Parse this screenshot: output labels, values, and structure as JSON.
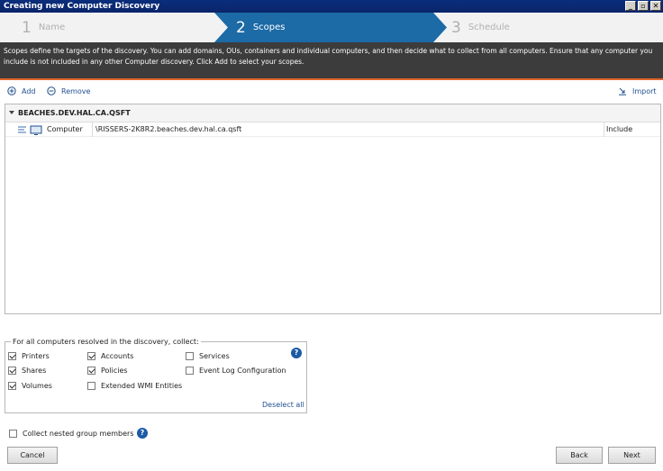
{
  "window": {
    "title": "Creating new Computer Discovery",
    "buttons": [
      "_",
      "▫",
      "✕"
    ]
  },
  "wizard": {
    "steps": [
      {
        "num": "1",
        "label": "Name"
      },
      {
        "num": "2",
        "label": "Scopes"
      },
      {
        "num": "3",
        "label": "Schedule"
      }
    ],
    "active_index": 1,
    "colors": {
      "active": "#1c6aa6",
      "inactive": "#f2f2f2",
      "accent": "#e0652a"
    }
  },
  "info": {
    "text": "Scopes define the targets of the discovery. You can add domains, OUs, containers and individual computers, and then decide what to collect from all computers. Ensure that any computer you include is not included in any other Computer discovery. Click Add to select your scopes."
  },
  "toolbar": {
    "add_label": "Add",
    "remove_label": "Remove",
    "import_label": "Import"
  },
  "scopes": {
    "group_name": "BEACHES.DEV.HAL.CA.QSFT",
    "rows": [
      {
        "type": "Computer",
        "path": "\\RISSERS-2K8R2.beaches.dev.hal.ca.qsft",
        "action": "Include"
      }
    ]
  },
  "collect": {
    "legend": "For all computers resolved in the discovery, collect:",
    "options": [
      {
        "label": "Printers",
        "checked": true
      },
      {
        "label": "Accounts",
        "checked": true
      },
      {
        "label": "Services",
        "checked": false
      },
      {
        "label": "Shares",
        "checked": true
      },
      {
        "label": "Policies",
        "checked": true
      },
      {
        "label": "Event Log Configuration",
        "checked": false
      },
      {
        "label": "Volumes",
        "checked": true
      },
      {
        "label": "Extended WMI Entities",
        "checked": false
      }
    ],
    "deselect_label": "Deselect all",
    "help_label": "?"
  },
  "nested": {
    "label": "Collect nested group members",
    "checked": false,
    "help_label": "?"
  },
  "footer": {
    "cancel_label": "Cancel",
    "back_label": "Back",
    "next_label": "Next"
  }
}
